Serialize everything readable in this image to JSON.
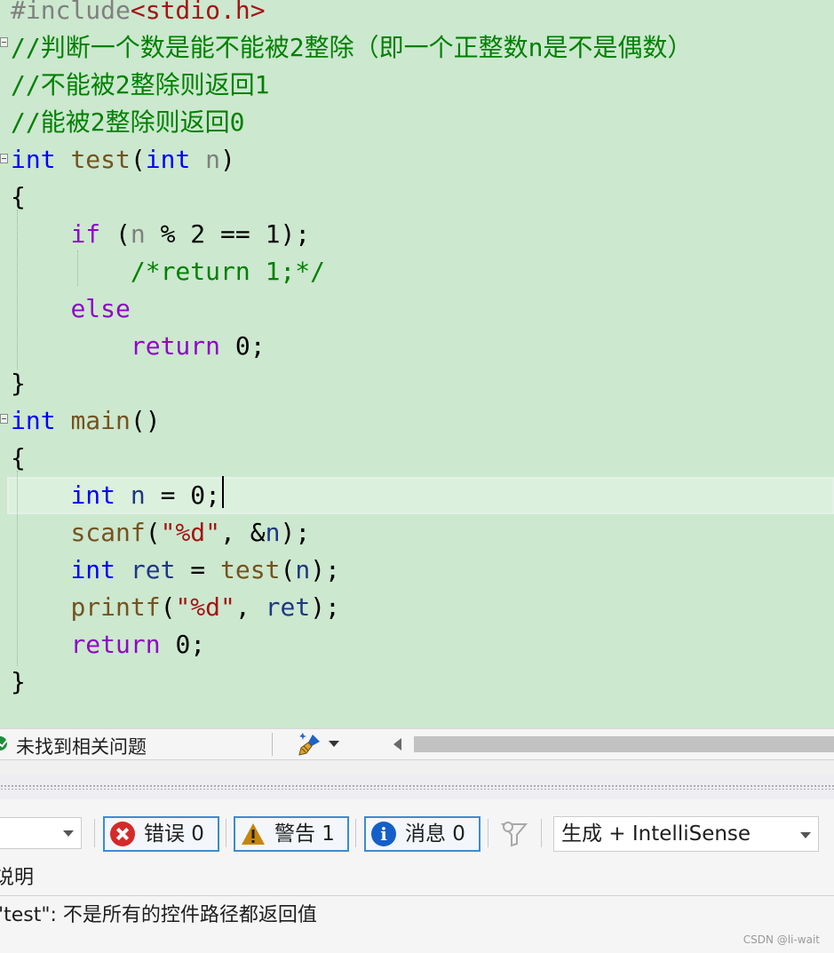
{
  "editor": {
    "lines": [
      [
        {
          "t": "#include",
          "c": "pre"
        },
        {
          "t": "<stdio.h>",
          "c": "hdr"
        }
      ],
      [
        {
          "t": "//判断一个数是能不能被2整除（即一个正整数n是不是偶数）",
          "c": "cmt"
        }
      ],
      [
        {
          "t": "//不能被2整除则返回1",
          "c": "cmt"
        }
      ],
      [
        {
          "t": "//能被2整除则返回0",
          "c": "cmt"
        }
      ],
      [
        {
          "t": "int",
          "c": "kw"
        },
        {
          "t": " "
        },
        {
          "t": "test",
          "c": "fn"
        },
        {
          "t": "("
        },
        {
          "t": "int",
          "c": "kw"
        },
        {
          "t": " "
        },
        {
          "t": "n",
          "c": "prm"
        },
        {
          "t": ")"
        }
      ],
      [
        {
          "t": "{"
        }
      ],
      [
        {
          "t": "    "
        },
        {
          "t": "if",
          "c": "ctl"
        },
        {
          "t": " ("
        },
        {
          "t": "n",
          "c": "prm"
        },
        {
          "t": " % 2 == 1);"
        }
      ],
      [
        {
          "t": "        "
        },
        {
          "t": "/*return 1;*/",
          "c": "cmt"
        }
      ],
      [
        {
          "t": "    "
        },
        {
          "t": "else",
          "c": "ctl"
        }
      ],
      [
        {
          "t": "        "
        },
        {
          "t": "return",
          "c": "ctl"
        },
        {
          "t": " 0;"
        }
      ],
      [
        {
          "t": "}"
        }
      ],
      [
        {
          "t": "int",
          "c": "kw"
        },
        {
          "t": " "
        },
        {
          "t": "main",
          "c": "fn"
        },
        {
          "t": "()"
        }
      ],
      [
        {
          "t": "{"
        }
      ],
      [
        {
          "t": "    "
        },
        {
          "t": "int",
          "c": "kw"
        },
        {
          "t": " "
        },
        {
          "t": "n",
          "c": "var"
        },
        {
          "t": " = 0;"
        }
      ],
      [
        {
          "t": "    "
        },
        {
          "t": "scanf",
          "c": "fn"
        },
        {
          "t": "("
        },
        {
          "t": "\"%d\"",
          "c": "str"
        },
        {
          "t": ", &"
        },
        {
          "t": "n",
          "c": "var"
        },
        {
          "t": ");"
        }
      ],
      [
        {
          "t": "    "
        },
        {
          "t": "int",
          "c": "kw"
        },
        {
          "t": " "
        },
        {
          "t": "ret",
          "c": "var"
        },
        {
          "t": " = "
        },
        {
          "t": "test",
          "c": "fn"
        },
        {
          "t": "("
        },
        {
          "t": "n",
          "c": "var"
        },
        {
          "t": ");"
        }
      ],
      [
        {
          "t": "    "
        },
        {
          "t": "printf",
          "c": "fn"
        },
        {
          "t": "("
        },
        {
          "t": "\"%d\"",
          "c": "str"
        },
        {
          "t": ", "
        },
        {
          "t": "ret",
          "c": "var"
        },
        {
          "t": ");"
        }
      ],
      [
        {
          "t": "    "
        },
        {
          "t": "return",
          "c": "ctl"
        },
        {
          "t": " 0;"
        }
      ],
      [
        {
          "t": "}"
        }
      ]
    ]
  },
  "status_bar": {
    "issues_text": "未找到相关问题"
  },
  "error_list": {
    "errors_label": "错误 0",
    "warnings_label": "警告 1",
    "messages_label": "消息 0",
    "source_filter": "生成 + IntelliSense",
    "column_description": "说明",
    "rows": [
      {
        "description": "\"test\": 不是所有的控件路径都返回值"
      }
    ]
  },
  "watermark": "CSDN @li-wait",
  "colors": {
    "editor_background": "#cce8cf",
    "keyword": "#0000ff",
    "control_keyword": "#8f08c4",
    "function": "#74531f",
    "comment": "#008000",
    "string": "#a31515",
    "error_icon": "#d42a2a",
    "warning_icon": "#c8840c",
    "info_icon": "#1460c8"
  },
  "icons": {
    "status_ok": "check-circle-icon",
    "code_cleanup": "brush-icon",
    "error": "error-icon",
    "warning": "warning-icon",
    "info": "info-icon",
    "filter": "filter-icon"
  }
}
